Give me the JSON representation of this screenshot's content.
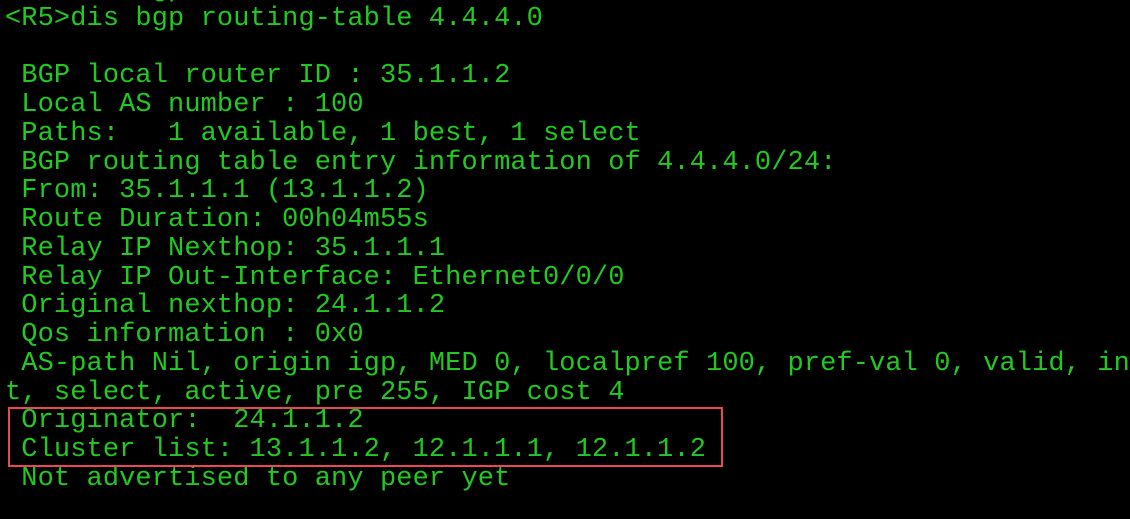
{
  "terminal": {
    "lines": [
      "         gp",
      "<R5>dis bgp routing-table 4.4.4.0",
      "",
      " BGP local router ID : 35.1.1.2",
      " Local AS number : 100",
      " Paths:   1 available, 1 best, 1 select",
      " BGP routing table entry information of 4.4.4.0/24:",
      " From: 35.1.1.1 (13.1.1.2)",
      " Route Duration: 00h04m55s",
      " Relay IP Nexthop: 35.1.1.1",
      " Relay IP Out-Interface: Ethernet0/0/0",
      " Original nexthop: 24.1.1.2",
      " Qos information : 0x0",
      " AS-path Nil, origin igp, MED 0, localpref 100, pref-val 0, valid, internal, bes",
      "t, select, active, pre 255, IGP cost 4",
      " Originator:  24.1.1.2",
      " Cluster list: 13.1.1.2, 12.1.1.1, 12.1.1.2",
      " Not advertised to any peer yet"
    ],
    "text_color": "#22c922",
    "highlight_color": "#e8484e"
  }
}
